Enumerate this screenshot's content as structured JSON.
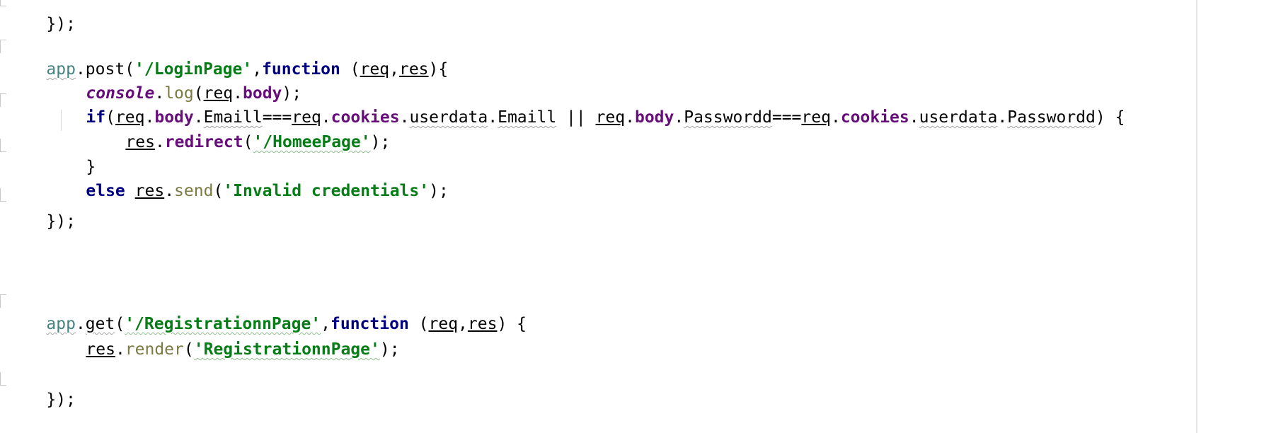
{
  "code": {
    "line0": {
      "text": "});"
    },
    "post_block": {
      "obj": "app",
      "dot": ".",
      "method": "post",
      "open": "(",
      "route": "'/LoginPage'",
      "comma": ",",
      "func_kw": "function",
      "params_open": " (",
      "p1": "req",
      "p_sep": ",",
      "p2": "res",
      "params_close": "){",
      "console_obj": "console",
      "console_fn": "log",
      "console_arg1": "req",
      "console_arg2": "body",
      "console_end": ");",
      "if_kw": "if",
      "if_open": "(",
      "c_req1": "req",
      "c_body1": "body",
      "c_email1": "Emaill",
      "c_eq": "===",
      "c_req2": "req",
      "c_cookies1": "cookies",
      "c_userdata1": "userdata",
      "c_email2": "Emaill",
      "c_or": " || ",
      "c_req3": "req",
      "c_body2": "body",
      "c_pass1": "Passwordd",
      "c_eq2": "===",
      "c_req4": "req",
      "c_cookies2": "cookies",
      "c_userdata2": "userdata",
      "c_pass2": "Passwordd",
      "if_close": ") {",
      "redir_obj": "res",
      "redir_fn": "redirect",
      "redir_open": "(",
      "redir_arg": "'/HomeePage'",
      "redir_end": ");",
      "close_brace": "}",
      "else_kw": "else",
      "send_obj": "res",
      "send_fn": "send",
      "send_open": "(",
      "send_arg": "'Invalid credentials'",
      "send_end": ");",
      "end": "});"
    },
    "get_block": {
      "obj": "app",
      "dot": ".",
      "method": "get",
      "open": "(",
      "route": "'/RegistrationnPage'",
      "comma": ",",
      "func_kw": "function",
      "params_open": " (",
      "p1": "req",
      "p_sep": ",",
      "p2": "res",
      "params_close": ") {",
      "render_obj": "res",
      "render_fn": "render",
      "render_open": "(",
      "render_arg": "'RegistrationnPage'",
      "render_end": ");",
      "end": "});"
    }
  },
  "colors": {
    "keyword": "#000080",
    "string": "#067d17",
    "property": "#660e7a",
    "function_call": "#7a7a43",
    "background": "#ffffff"
  }
}
